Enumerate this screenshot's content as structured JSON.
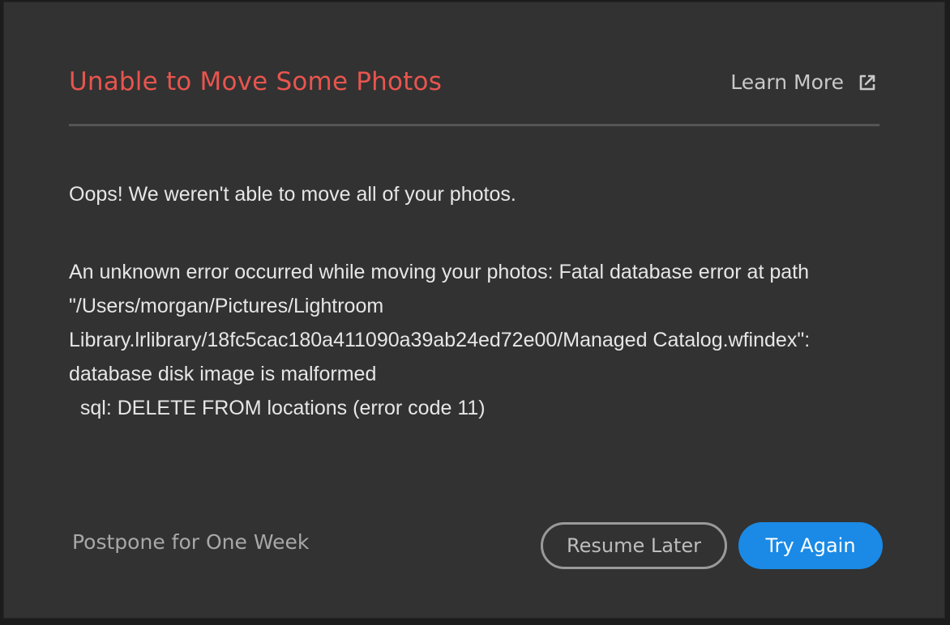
{
  "dialog": {
    "title": "Unable to Move Some Photos",
    "learn_more_label": "Learn More",
    "learn_more_icon": "external-link-icon",
    "message": "Oops! We weren't able to move all of your photos.",
    "error_details": "An unknown error occurred while moving your photos: Fatal database error at path \"/Users/morgan/Pictures/Lightroom Library.lrlibrary/18fc5cac180a411090a39ab24ed72e00/Managed Catalog.wfindex\": database disk image is malformed\n  sql: DELETE FROM locations (error code 11)",
    "postpone_label": "Postpone for One Week",
    "resume_label": "Resume Later",
    "try_again_label": "Try Again"
  },
  "colors": {
    "title": "#e8554e",
    "background": "#323232",
    "primary_button": "#1a8ae6"
  }
}
